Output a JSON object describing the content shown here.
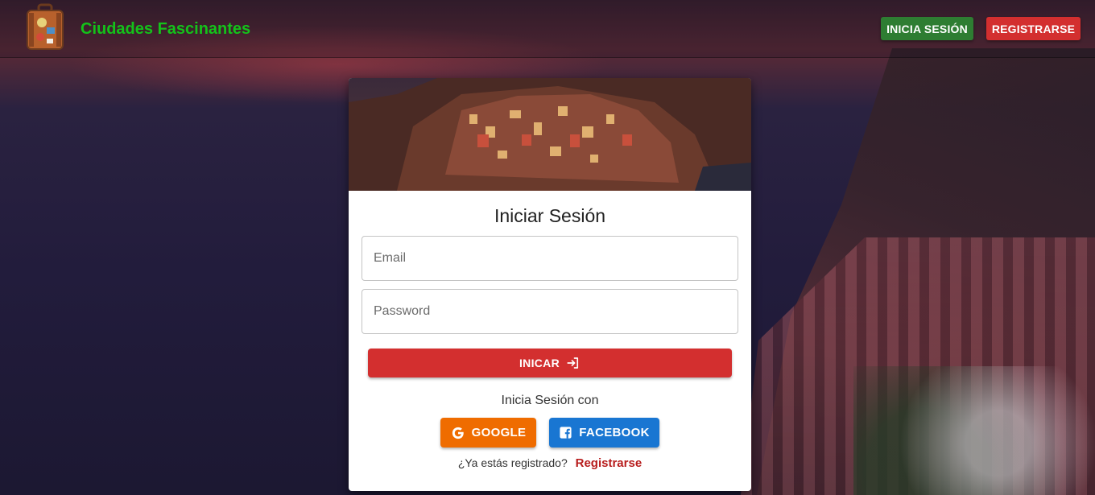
{
  "header": {
    "brand_title": "Ciudades Fascinantes",
    "login_button": "INICIA SESIÓN",
    "register_button": "REGISTRARSE"
  },
  "login_card": {
    "title": "Iniciar Sesión",
    "email_placeholder": "Email",
    "password_placeholder": "Password",
    "submit_label": "INICAR",
    "social_label": "Inicia Sesión con",
    "google_label": "GOOGLE",
    "facebook_label": "FACEBOOK",
    "registered_question": "¿Ya estás registrado?",
    "register_link": "Registrarse"
  },
  "colors": {
    "brand_green": "#14c21a",
    "login_green": "#2e7d32",
    "primary_red": "#d32f2f",
    "google_orange": "#ef6c00",
    "facebook_blue": "#1976d2",
    "link_red": "#b71c1c"
  },
  "icons": {
    "brand": "suitcase-icon",
    "submit": "login-arrow-icon",
    "google": "google-icon",
    "facebook": "facebook-icon"
  }
}
